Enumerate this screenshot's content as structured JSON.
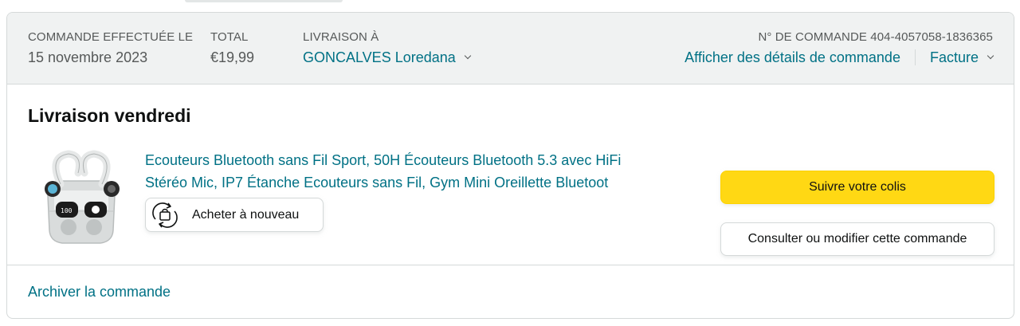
{
  "header": {
    "order_date_label": "COMMANDE EFFECTUÉE LE",
    "order_date_value": "15 novembre 2023",
    "total_label": "TOTAL",
    "total_value": "€19,99",
    "ship_to_label": "LIVRAISON À",
    "ship_to_value": "GONCALVES Loredana",
    "order_number_label": "N° DE COMMANDE 404-4057058-1836365",
    "details_link": "Afficher des détails de commande",
    "invoice_link": "Facture"
  },
  "shipment": {
    "status_title": "Livraison vendredi",
    "product_title_line1": "Ecouteurs Bluetooth sans Fil Sport, 50H Écouteurs Bluetooth 5.3 avec HiFi",
    "product_title_line2": "Stéréo Mic, IP7 Étanche Ecouteurs sans Fil, Gym Mini Oreillette Bluetoot",
    "buy_again_label": "Acheter à nouveau",
    "track_button_label": "Suivre votre colis",
    "view_edit_button_label": "Consulter ou modifier cette commande",
    "product_image_screen_text": "100"
  },
  "footer": {
    "archive_link": "Archiver la commande"
  },
  "colors": {
    "link": "#007185",
    "primary_button": "#ffd814",
    "header_bg": "#f0f2f2",
    "border": "#d5d9d9"
  },
  "icons": [
    "chevron-down-icon",
    "buy-again-icon",
    "product-image"
  ]
}
